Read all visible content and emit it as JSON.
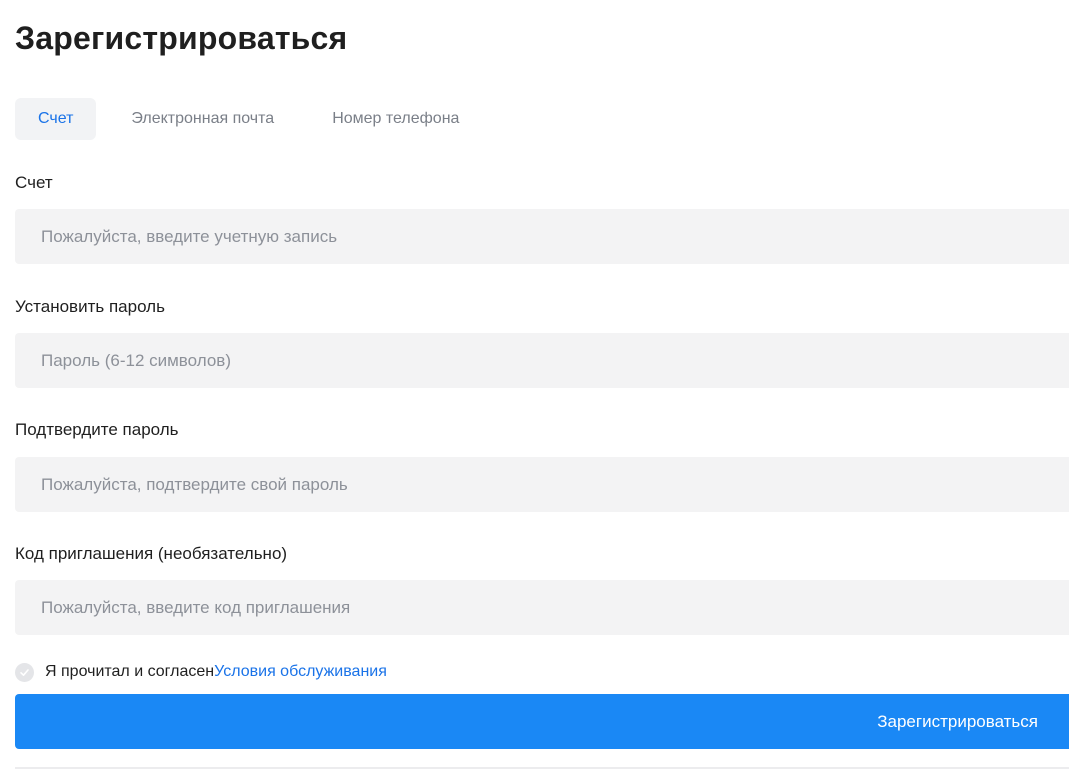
{
  "page": {
    "title": "Зарегистрироваться"
  },
  "tabs": [
    {
      "label": "Счет",
      "active": true
    },
    {
      "label": "Электронная почта",
      "active": false
    },
    {
      "label": "Номер телефона",
      "active": false
    }
  ],
  "fields": {
    "account": {
      "label": "Счет",
      "placeholder": "Пожалуйста, введите учетную запись",
      "value": ""
    },
    "password": {
      "label": "Установить пароль",
      "placeholder": "Пароль (6-12 символов)",
      "value": ""
    },
    "confirm_password": {
      "label": "Подтвердите пароль",
      "placeholder": "Пожалуйста, подтвердите свой пароль",
      "value": ""
    },
    "invite_code": {
      "label": "Код приглашения (необязательно)",
      "placeholder": "Пожалуйста, введите код приглашения",
      "value": ""
    }
  },
  "agreement": {
    "text": "Я прочитал и согласен",
    "link_text": "Условия обслуживания",
    "checked": false
  },
  "submit": {
    "label": "Зарегистрироваться"
  },
  "colors": {
    "accent": "#1a73e8",
    "button": "#1a88f5",
    "input_bg": "#f3f3f4"
  },
  "icons": {
    "checkbox": "check-circle-icon"
  }
}
